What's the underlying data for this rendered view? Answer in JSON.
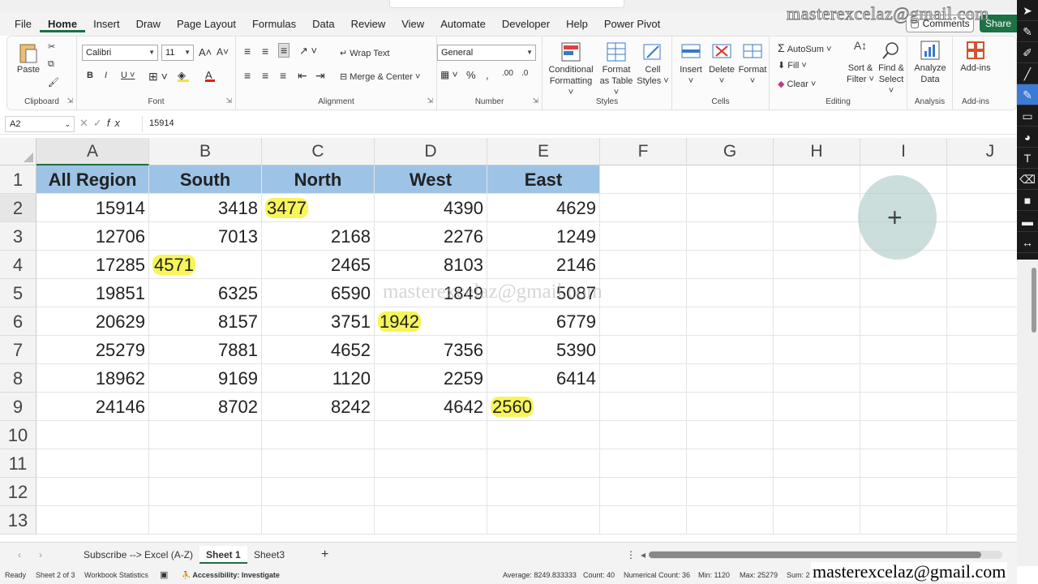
{
  "menu": {
    "tabs": [
      "File",
      "Home",
      "Insert",
      "Draw",
      "Page Layout",
      "Formulas",
      "Data",
      "Review",
      "View",
      "Automate",
      "Developer",
      "Help",
      "Power Pivot"
    ],
    "active_tab": "Home",
    "comments_label": "Comments",
    "share_label": "Share"
  },
  "ribbon": {
    "clipboard": {
      "label": "Clipboard",
      "paste": "Paste"
    },
    "font": {
      "label": "Font",
      "font_name": "Calibri",
      "font_size": "11"
    },
    "alignment": {
      "label": "Alignment",
      "wrap_text": "Wrap Text",
      "merge_center": "Merge & Center"
    },
    "number": {
      "label": "Number",
      "format": "General"
    },
    "styles": {
      "label": "Styles",
      "conditional_formatting": "Conditional Formatting",
      "format_as_table": "Format as Table",
      "cell_styles": "Cell Styles"
    },
    "cells": {
      "label": "Cells",
      "insert": "Insert",
      "delete": "Delete",
      "format": "Format"
    },
    "editing": {
      "label": "Editing",
      "autosum": "AutoSum",
      "fill": "Fill",
      "clear": "Clear",
      "sort_filter": "Sort & Filter",
      "find_select": "Find & Select"
    },
    "analysis": {
      "label": "Analysis",
      "analyze_data": "Analyze Data"
    },
    "addins": {
      "label": "Add-ins",
      "addins": "Add-ins"
    }
  },
  "formula_bar": {
    "name_box": "A2",
    "fx": "fx",
    "value": "15914"
  },
  "columns": [
    "A",
    "B",
    "C",
    "D",
    "E",
    "F",
    "G",
    "H",
    "I",
    "J"
  ],
  "rows": [
    "1",
    "2",
    "3",
    "4",
    "5",
    "6",
    "7",
    "8",
    "9",
    "10",
    "11",
    "12",
    "13"
  ],
  "table": {
    "headers": [
      "All Region",
      "South",
      "North",
      "West",
      "East"
    ],
    "data": [
      [
        "15914",
        "3418",
        "3477",
        "4390",
        "4629"
      ],
      [
        "12706",
        "7013",
        "2168",
        "2276",
        "1249"
      ],
      [
        "17285",
        "4571",
        "2465",
        "8103",
        "2146"
      ],
      [
        "19851",
        "6325",
        "6590",
        "1849",
        "5087"
      ],
      [
        "20629",
        "8157",
        "3751",
        "1942",
        "6779"
      ],
      [
        "25279",
        "7881",
        "4652",
        "7356",
        "5390"
      ],
      [
        "18962",
        "9169",
        "1120",
        "2259",
        "6414"
      ],
      [
        "24146",
        "8702",
        "8242",
        "4642",
        "2560"
      ]
    ]
  },
  "watermark": "masterexcelaz@gmail.com",
  "sheets": {
    "tabs": [
      "Subscribe --> Excel (A-Z)",
      "Sheet 1",
      "Sheet3"
    ],
    "active": "Sheet 1",
    "add": "+"
  },
  "status": {
    "ready": "Ready",
    "sheet_pos": "Sheet 2 of 3",
    "workbook_stats": "Workbook Statistics",
    "accessibility": "Accessibility: Investigate",
    "average": "Average: 8249.833333",
    "count": "Count: 40",
    "numerical_count": "Numerical Count: 36",
    "min": "Min: 1120",
    "max": "Max: 25279",
    "sum": "Sum: 2"
  },
  "colors": {
    "header_fill": "#9dc3e6",
    "highlight": "#f7f55a",
    "accent": "#1e6e42"
  }
}
